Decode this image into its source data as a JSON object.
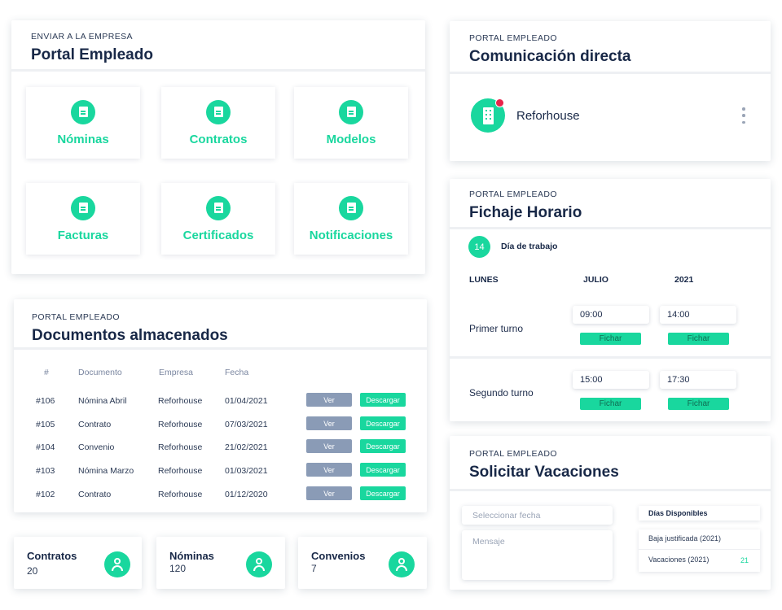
{
  "portal": {
    "eyebrow": "ENVIAR A LA EMPRESA",
    "title": "Portal Empleado",
    "tiles": [
      {
        "label": "Nóminas",
        "icon": "document-icon"
      },
      {
        "label": "Contratos",
        "icon": "document-icon"
      },
      {
        "label": "Modelos",
        "icon": "document-icon"
      },
      {
        "label": "Facturas",
        "icon": "document-icon"
      },
      {
        "label": "Certificados",
        "icon": "document-icon"
      },
      {
        "label": "Notificaciones",
        "icon": "document-icon"
      }
    ]
  },
  "docs": {
    "eyebrow": "PORTAL EMPLEADO",
    "title": "Documentos almacenados",
    "columns": [
      "#",
      "Documento",
      "Empresa",
      "Fecha"
    ],
    "view_label": "Ver",
    "download_label": "Descargar",
    "rows": [
      {
        "id": "#106",
        "doc": "Nómina Abril",
        "company": "Reforhouse",
        "date": "01/04/2021"
      },
      {
        "id": "#105",
        "doc": "Contrato",
        "company": "Reforhouse",
        "date": "07/03/2021"
      },
      {
        "id": "#104",
        "doc": "Convenio",
        "company": "Reforhouse",
        "date": "21/02/2021"
      },
      {
        "id": "#103",
        "doc": "Nómina Marzo",
        "company": "Reforhouse",
        "date": "01/03/2021"
      },
      {
        "id": "#102",
        "doc": "Contrato",
        "company": "Reforhouse",
        "date": "01/12/2020"
      }
    ]
  },
  "stats": [
    {
      "name": "Contratos",
      "value": "20"
    },
    {
      "name": "Nóminas",
      "value": "120"
    },
    {
      "name": "Convenios",
      "value": "7"
    }
  ],
  "comm": {
    "eyebrow": "PORTAL EMPLEADO",
    "title": "Comunicación directa",
    "contact": "Reforhouse"
  },
  "fichaje": {
    "eyebrow": "PORTAL EMPLEADO",
    "title": "Fichaje Horario",
    "day_number": "14",
    "day_label": "Día de trabajo",
    "headers": [
      "LUNES",
      "JULIO",
      "2021"
    ],
    "button_label": "Fichar",
    "shifts": [
      {
        "name": "Primer turno",
        "start": "09:00",
        "end": "14:00"
      },
      {
        "name": "Segundo turno",
        "start": "15:00",
        "end": "17:30"
      }
    ]
  },
  "vac": {
    "eyebrow": "PORTAL EMPLEADO",
    "title": "Solicitar Vacaciones",
    "date_placeholder": "Seleccionar fecha",
    "message_placeholder": "Mensaje",
    "available_title": "Días Disponibles",
    "available": [
      {
        "label": "Baja justificada (2021)",
        "value": ""
      },
      {
        "label": "Vacaciones (2021)",
        "value": "21"
      }
    ]
  },
  "colors": {
    "accent": "#19d79e",
    "muted_button": "#8a9bb6",
    "alert": "#e8234a",
    "text": "#182847"
  }
}
